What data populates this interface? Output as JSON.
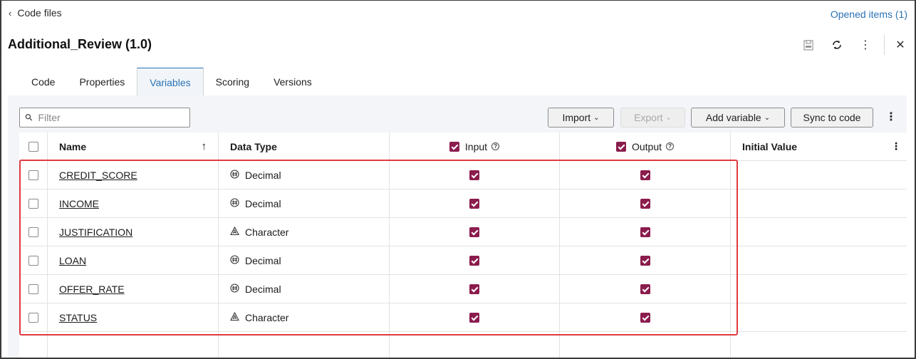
{
  "nav": {
    "back_label": "Code files",
    "opened_items": "Opened items (1)"
  },
  "header": {
    "title": "Additional_Review (1.0)"
  },
  "tabs": [
    {
      "label": "Code",
      "active": false
    },
    {
      "label": "Properties",
      "active": false
    },
    {
      "label": "Variables",
      "active": true
    },
    {
      "label": "Scoring",
      "active": false
    },
    {
      "label": "Versions",
      "active": false
    }
  ],
  "toolbar": {
    "filter_placeholder": "Filter",
    "import_label": "Import",
    "export_label": "Export",
    "add_variable_label": "Add variable",
    "sync_label": "Sync to code"
  },
  "table": {
    "columns": {
      "name": "Name",
      "data_type": "Data Type",
      "input": "Input",
      "output": "Output",
      "initial_value": "Initial Value"
    },
    "rows": [
      {
        "name": "CREDIT_SCORE",
        "type": "Decimal",
        "type_icon": "decimal-icon",
        "input": true,
        "output": true,
        "initial_value": ""
      },
      {
        "name": "INCOME",
        "type": "Decimal",
        "type_icon": "decimal-icon",
        "input": true,
        "output": true,
        "initial_value": ""
      },
      {
        "name": "JUSTIFICATION",
        "type": "Character",
        "type_icon": "character-icon",
        "input": true,
        "output": true,
        "initial_value": ""
      },
      {
        "name": "LOAN",
        "type": "Decimal",
        "type_icon": "decimal-icon",
        "input": true,
        "output": true,
        "initial_value": ""
      },
      {
        "name": "OFFER_RATE",
        "type": "Decimal",
        "type_icon": "decimal-icon",
        "input": true,
        "output": true,
        "initial_value": ""
      },
      {
        "name": "STATUS",
        "type": "Character",
        "type_icon": "character-icon",
        "input": true,
        "output": true,
        "initial_value": ""
      }
    ]
  },
  "colors": {
    "accent": "#2a72b5",
    "checkbox": "#8b1d4d",
    "highlight": "#e0393e"
  }
}
